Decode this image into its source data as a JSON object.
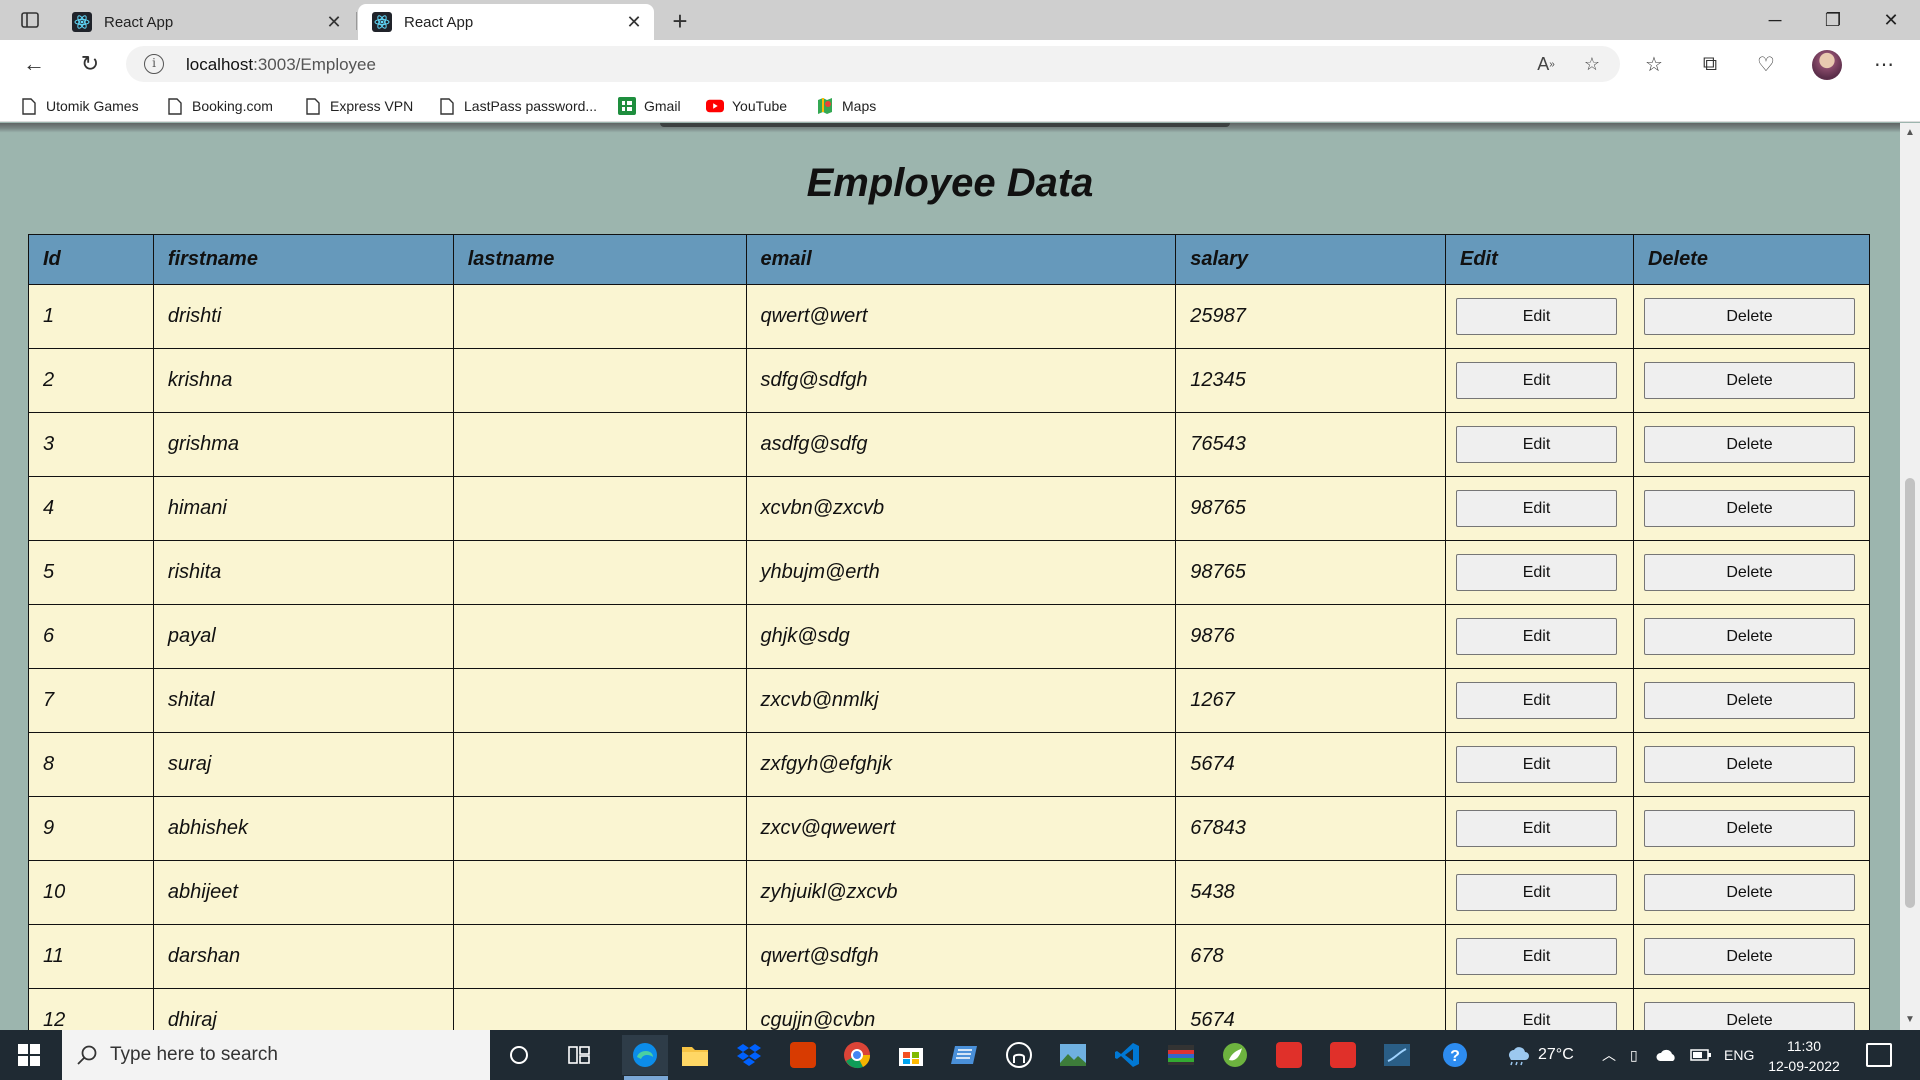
{
  "browser": {
    "tabs": [
      {
        "title": "React App",
        "active": false
      },
      {
        "title": "React App",
        "active": true
      }
    ],
    "url_host": "localhost",
    "url_rest": ":3003/Employee",
    "bookmarks": [
      "Utomik Games",
      "Booking.com",
      "Express VPN",
      "LastPass password...",
      "Gmail",
      "YouTube",
      "Maps"
    ]
  },
  "page": {
    "title": "Employee Data",
    "columns": [
      "Id",
      "firstname",
      "lastname",
      "email",
      "salary",
      "Edit",
      "Delete"
    ],
    "edit_label": "Edit",
    "delete_label": "Delete",
    "rows": [
      {
        "id": "1",
        "firstname": "drishti",
        "lastname": "",
        "email": "qwert@wert",
        "salary": "25987"
      },
      {
        "id": "2",
        "firstname": "krishna",
        "lastname": "",
        "email": "sdfg@sdfgh",
        "salary": "12345"
      },
      {
        "id": "3",
        "firstname": "grishma",
        "lastname": "",
        "email": "asdfg@sdfg",
        "salary": "76543"
      },
      {
        "id": "4",
        "firstname": "himani",
        "lastname": "",
        "email": "xcvbn@zxcvb",
        "salary": "98765"
      },
      {
        "id": "5",
        "firstname": "rishita",
        "lastname": "",
        "email": "yhbujm@erth",
        "salary": "98765"
      },
      {
        "id": "6",
        "firstname": "payal",
        "lastname": "",
        "email": "ghjk@sdg",
        "salary": "9876"
      },
      {
        "id": "7",
        "firstname": "shital",
        "lastname": "",
        "email": "zxcvb@nmlkj",
        "salary": "1267"
      },
      {
        "id": "8",
        "firstname": "suraj",
        "lastname": "",
        "email": "zxfgyh@efghjk",
        "salary": "5674"
      },
      {
        "id": "9",
        "firstname": "abhishek",
        "lastname": "",
        "email": "zxcv@qwewert",
        "salary": "67843"
      },
      {
        "id": "10",
        "firstname": "abhijeet",
        "lastname": "",
        "email": "zyhjuikl@zxcvb",
        "salary": "5438"
      },
      {
        "id": "11",
        "firstname": "darshan",
        "lastname": "",
        "email": "qwert@sdfgh",
        "salary": "678"
      },
      {
        "id": "12",
        "firstname": "dhiraj",
        "lastname": "",
        "email": "cgujjn@cvbn",
        "salary": "5674"
      }
    ]
  },
  "taskbar": {
    "search_placeholder": "Type here to search",
    "temperature": "27°C",
    "language": "ENG",
    "time": "11:30",
    "date": "12-09-2022"
  },
  "colors": {
    "page_bg": "#9cb5ae",
    "header_bg": "#6699bb",
    "row_bg": "#faf5d2"
  }
}
